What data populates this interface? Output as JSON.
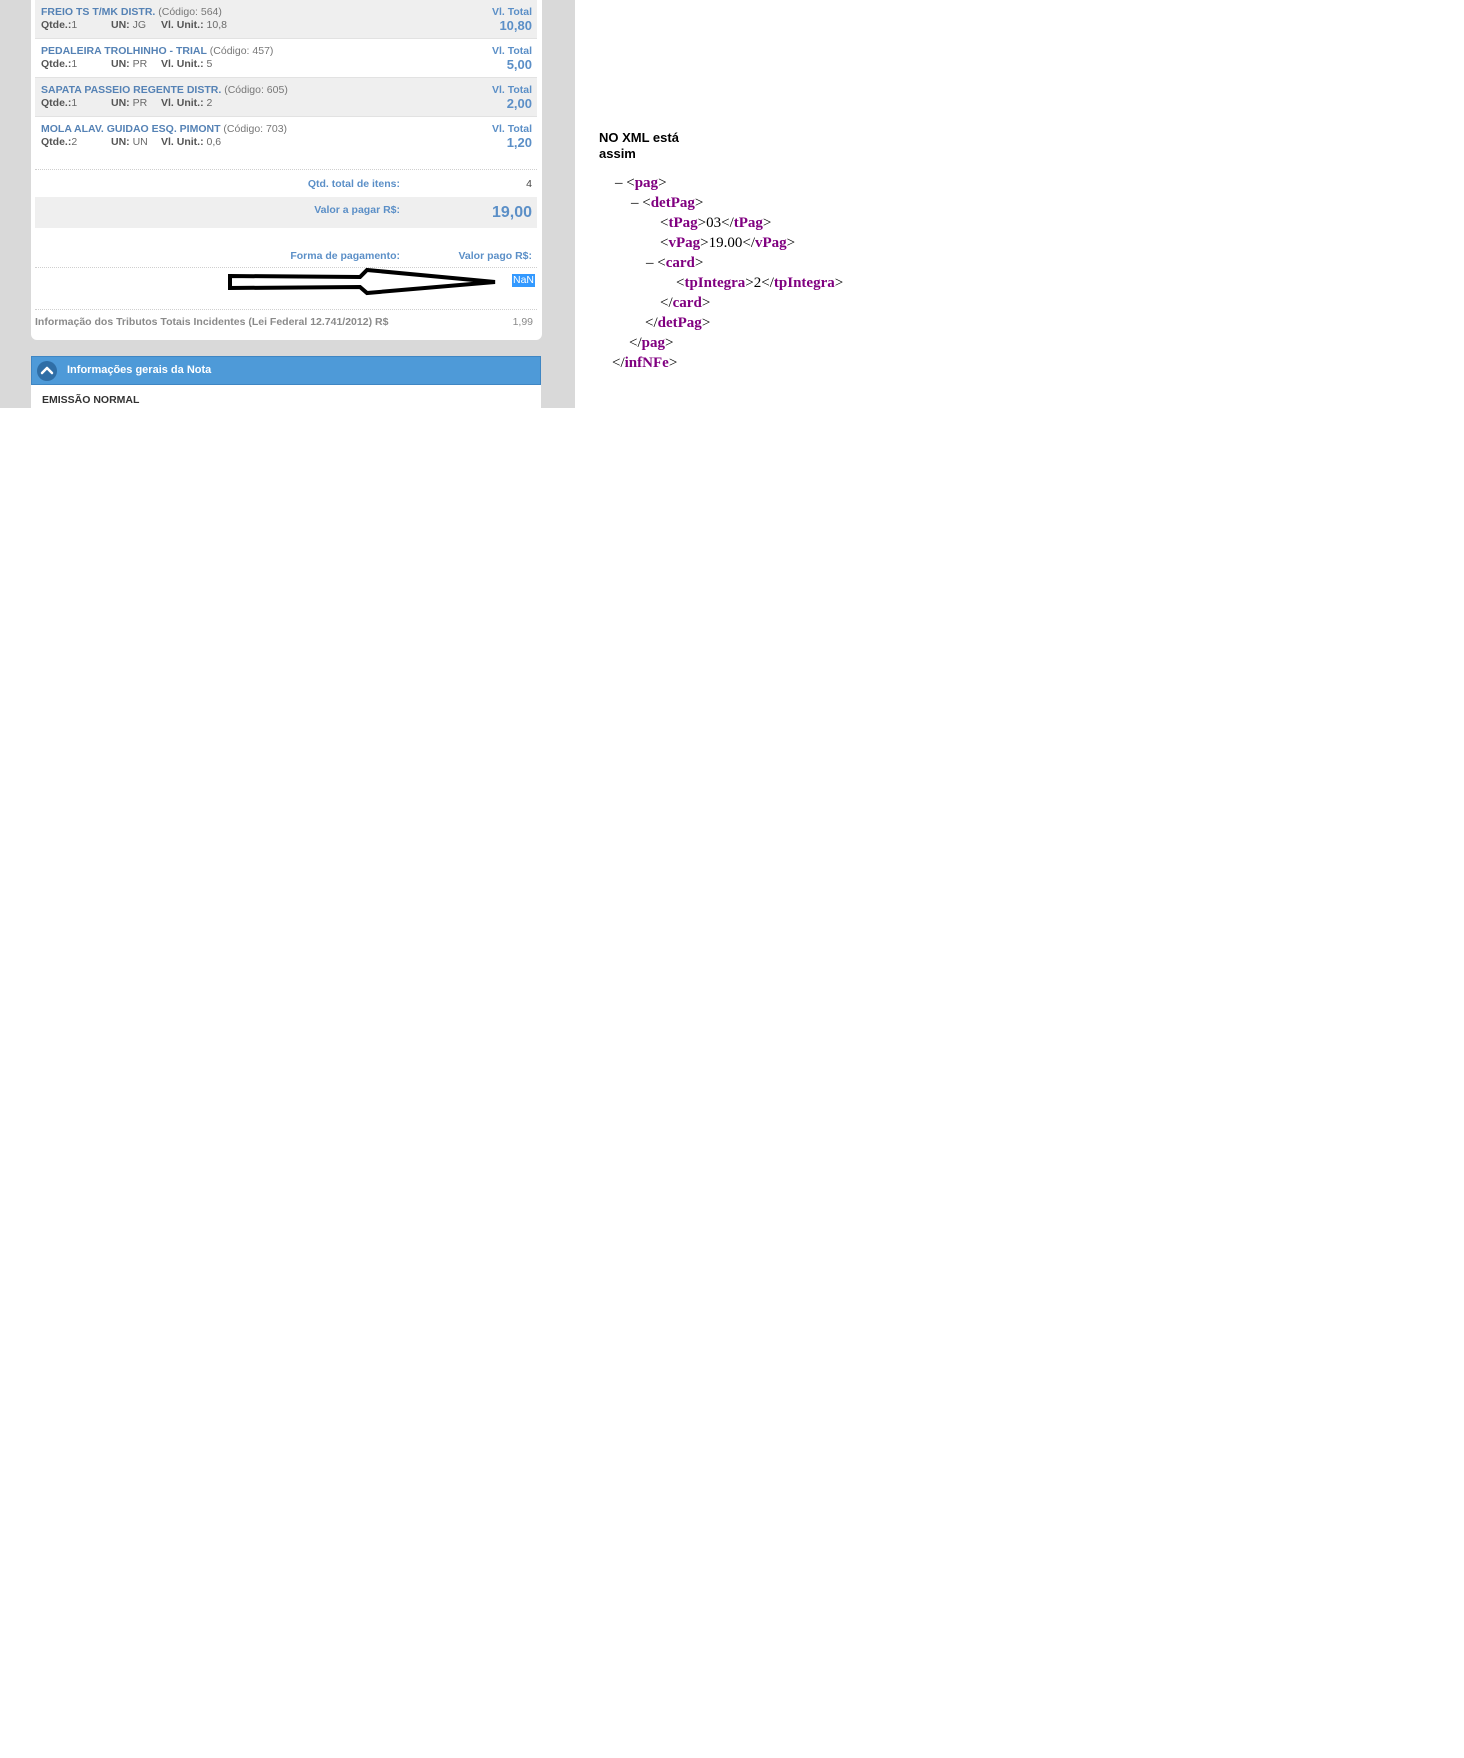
{
  "items": [
    {
      "name": "FREIO TS T/MK DISTR.",
      "code": "(Código: 564)",
      "qtde_label": "Qtde.:",
      "qtde": "1",
      "un_label": "UN:",
      "un": "JG",
      "vu_label": "Vl. Unit.:",
      "vu": "10,8",
      "total_label": "Vl. Total",
      "total": "10,80"
    },
    {
      "name": "PEDALEIRA TROLHINHO - TRIAL",
      "code": "(Código: 457)",
      "qtde_label": "Qtde.:",
      "qtde": "1",
      "un_label": "UN:",
      "un": "PR",
      "vu_label": "Vl. Unit.:",
      "vu": "5",
      "total_label": "Vl. Total",
      "total": "5,00"
    },
    {
      "name": "SAPATA PASSEIO REGENTE DISTR.",
      "code": "(Código: 605)",
      "qtde_label": "Qtde.:",
      "qtde": "1",
      "un_label": "UN:",
      "un": "PR",
      "vu_label": "Vl. Unit.:",
      "vu": "2",
      "total_label": "Vl. Total",
      "total": "2,00"
    },
    {
      "name": "MOLA ALAV. GUIDAO ESQ. PIMONT",
      "code": "(Código: 703)",
      "qtde_label": "Qtde.:",
      "qtde": "2",
      "un_label": "UN:",
      "un": "UN",
      "vu_label": "Vl. Unit.:",
      "vu": "0,6",
      "total_label": "Vl. Total",
      "total": "1,20"
    }
  ],
  "totals": {
    "qtd_label": "Qtd. total de itens:",
    "qtd_value": "4",
    "pagar_label": "Valor a pagar R$:",
    "pagar_value": "19,00",
    "forma_label": "Forma de pagamento:",
    "valor_pago_label": "Valor pago R$:",
    "valor_pago_value": "NaN"
  },
  "tributos": {
    "label": "Informação dos Tributos Totais Incidentes (Lei Federal 12.741/2012) R$",
    "value": "1,99"
  },
  "info_section": {
    "title": "Informações gerais da Nota",
    "emissao": "EMISSÃO NORMAL"
  },
  "annotation": {
    "title": "NO XML está assim",
    "minus": "–",
    "pag": "pag",
    "detPag": "detPag",
    "tPag": "tPag",
    "tPag_value": "03",
    "vPag": "vPag",
    "vPag_value": "19.00",
    "card": "card",
    "tpIntegra": "tpIntegra",
    "tpIntegra_value": "2",
    "infNFe": "infNFe"
  },
  "colors": {
    "accent_blue": "#5b8fc7",
    "header_blue": "#4e9ad8",
    "selection_blue": "#3399ff",
    "xml_tag_purple": "#800080"
  }
}
